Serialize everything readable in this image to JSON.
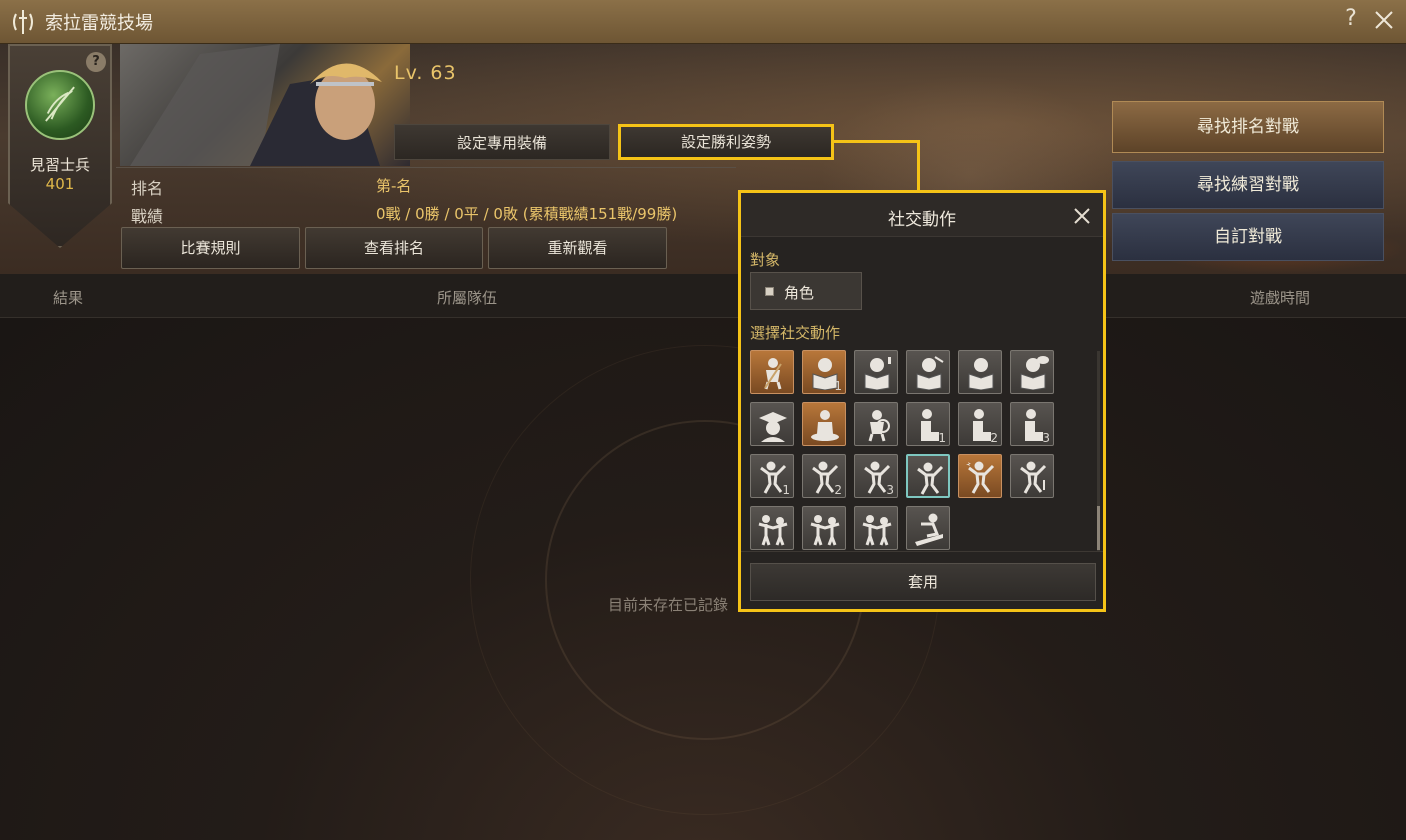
{
  "window": {
    "title": "索拉雷競技場",
    "help": "?"
  },
  "rank": {
    "name": "見習士兵",
    "score": "401",
    "help": "?"
  },
  "player": {
    "level": "Lv. 63"
  },
  "tabs": {
    "equip": "設定專用裝備",
    "pose": "設定勝利姿勢"
  },
  "stats": {
    "rank_label": "排名",
    "rank_value": "第-名",
    "record_label": "戰績",
    "record_value": "0戰 / 0勝 / 0平 / 0敗 (累積戰績151戰/99勝)"
  },
  "buttons": {
    "rules": "比賽規則",
    "view_rank": "查看排名",
    "replay": "重新觀看"
  },
  "side": {
    "ranked": "尋找排名對戰",
    "practice": "尋找練習對戰",
    "custom": "自訂對戰"
  },
  "columns": {
    "result": "結果",
    "team": "所屬隊伍",
    "time": "遊戲時間"
  },
  "list": {
    "empty": "目前未存在已記錄"
  },
  "dialog": {
    "title": "社交動作",
    "target_label": "對象",
    "target_value": "角色",
    "choose_label": "選擇社交動作",
    "apply": "套用",
    "emotes": [
      {
        "icon": "sweep-icon",
        "style": "orange"
      },
      {
        "icon": "reading-book-icon",
        "style": "orange",
        "num": "1"
      },
      {
        "icon": "reading-exclaim-icon",
        "style": "gray"
      },
      {
        "icon": "reading-angry-icon",
        "style": "gray"
      },
      {
        "icon": "reading-think-icon",
        "style": "gray"
      },
      {
        "icon": "reading-talk-icon",
        "style": "gray"
      },
      {
        "icon": "graduate-icon",
        "style": "gray"
      },
      {
        "icon": "meditate-icon",
        "style": "orange"
      },
      {
        "icon": "magnify-icon",
        "style": "gray"
      },
      {
        "icon": "sit-icon",
        "style": "gray",
        "num": "1"
      },
      {
        "icon": "sit-icon",
        "style": "gray",
        "num": "2"
      },
      {
        "icon": "sit-icon",
        "style": "gray",
        "num": "3"
      },
      {
        "icon": "dance-icon",
        "style": "gray",
        "num": "1"
      },
      {
        "icon": "dance-icon",
        "style": "gray",
        "num": "2"
      },
      {
        "icon": "dance-icon",
        "style": "gray",
        "num": "3"
      },
      {
        "icon": "dance-glow-icon",
        "style": "selected"
      },
      {
        "icon": "dance-star-icon",
        "style": "orange"
      },
      {
        "icon": "dance-music-icon",
        "style": "gray"
      },
      {
        "icon": "pair-cheer-icon",
        "style": "gray"
      },
      {
        "icon": "pair-dance-icon",
        "style": "gray"
      },
      {
        "icon": "pair-walk-icon",
        "style": "gray"
      },
      {
        "icon": "surf-icon",
        "style": "gray"
      }
    ]
  }
}
